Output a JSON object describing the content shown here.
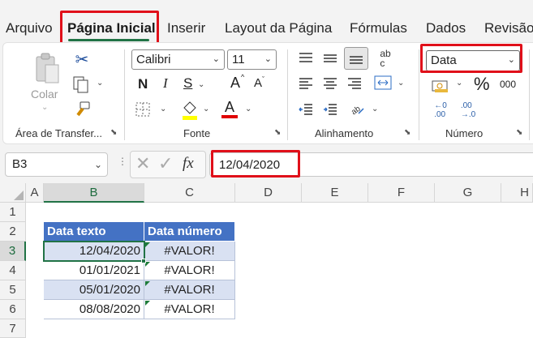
{
  "menu": {
    "tabs": [
      "Arquivo",
      "Página Inicial",
      "Inserir",
      "Layout da Página",
      "Fórmulas",
      "Dados",
      "Revisão"
    ],
    "active_tab": "Página Inicial"
  },
  "ribbon": {
    "clipboard": {
      "label": "Área de Transfer...",
      "paste_label": "Colar"
    },
    "font": {
      "label": "Fonte",
      "font_name": "Calibri",
      "font_size": "11",
      "bold": "N",
      "grow": "A",
      "shrink": "A",
      "color_letter": "A",
      "fill_color": "#ffff00",
      "font_color": "#e00000"
    },
    "alignment": {
      "label": "Alinhamento",
      "wrap": "ab\nc"
    },
    "number": {
      "label": "Número",
      "format": "Data",
      "percent": "%",
      "thousands": "000",
      "inc_decimal": "←0\n.00",
      "dec_decimal": ".00\n→.0"
    }
  },
  "formula_bar": {
    "cell_ref": "B3",
    "fx": "fx",
    "formula": "12/04/2020"
  },
  "sheet": {
    "columns": [
      "A",
      "B",
      "C",
      "D",
      "E",
      "F",
      "G",
      "H"
    ],
    "rows": [
      "1",
      "2",
      "3",
      "4",
      "5",
      "6",
      "7"
    ],
    "selected_cell": "B3",
    "table": {
      "headers": [
        "Data texto",
        "Data número"
      ],
      "rows": [
        [
          "12/04/2020",
          "#VALOR!"
        ],
        [
          "01/01/2021",
          "#VALOR!"
        ],
        [
          "05/01/2020",
          "#VALOR!"
        ],
        [
          "08/08/2020",
          "#VALOR!"
        ]
      ]
    }
  },
  "colors": {
    "accent": "#217346",
    "highlight_box": "#e0101a",
    "table_header": "#4472c4",
    "table_band": "#d9e1f2"
  }
}
